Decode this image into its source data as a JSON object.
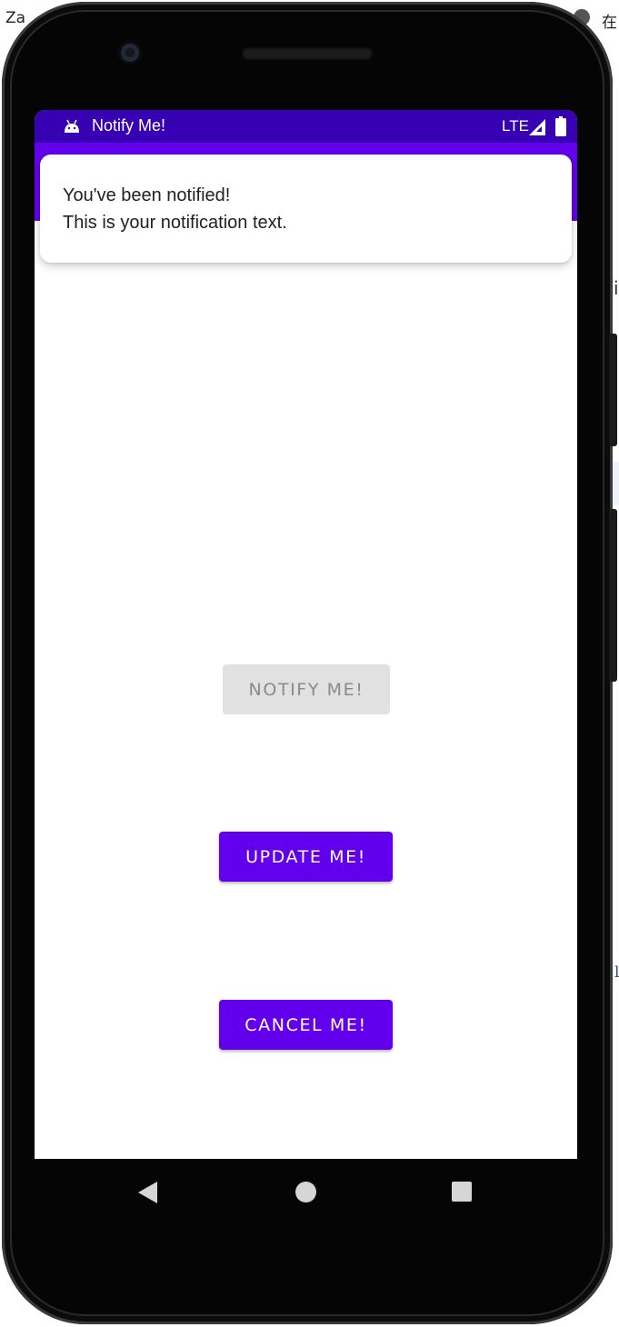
{
  "desktop": {
    "left_text": "Za",
    "right_text": "在",
    "mid_text": "i",
    "mid_text_2": "l"
  },
  "status_bar": {
    "app_name": "Notify Me!",
    "network": "LTE",
    "icons": [
      "android-icon",
      "signal-icon",
      "battery-icon"
    ]
  },
  "notification": {
    "title": "You've been notified!",
    "text": "This is your notification text."
  },
  "buttons": {
    "notify": "NOTIFY ME!",
    "update": "UPDATE ME!",
    "cancel": "CANCEL ME!"
  },
  "nav_bar": {
    "icons": [
      "back-icon",
      "home-icon",
      "recents-icon"
    ]
  },
  "colors": {
    "primary": "#6200ee",
    "primary_dark": "#3700b3",
    "disabled_bg": "#e1e1e1",
    "disabled_text": "#8a8a8a"
  }
}
